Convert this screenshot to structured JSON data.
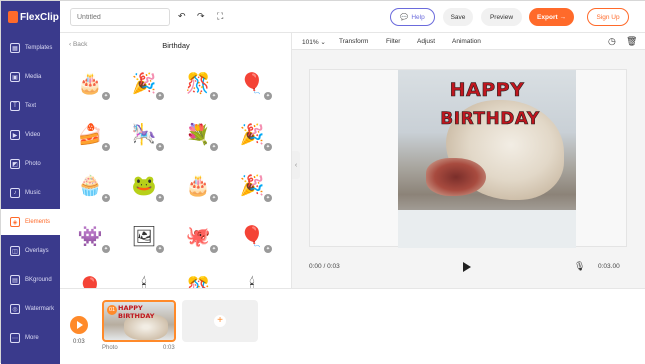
{
  "app": {
    "brand": "FlexClip"
  },
  "sidebar": {
    "items": [
      {
        "label": "Templates",
        "icon": "templates-icon",
        "glyph": "▦"
      },
      {
        "label": "Media",
        "icon": "media-icon",
        "glyph": "▣"
      },
      {
        "label": "Text",
        "icon": "text-icon",
        "glyph": "T"
      },
      {
        "label": "Video",
        "icon": "video-icon",
        "glyph": "▶"
      },
      {
        "label": "Photo",
        "icon": "photo-icon",
        "glyph": "◩"
      },
      {
        "label": "Music",
        "icon": "music-icon",
        "glyph": "♪"
      },
      {
        "label": "Elements",
        "icon": "elements-icon",
        "glyph": "◈",
        "active": true
      },
      {
        "label": "Overlays",
        "icon": "overlays-icon",
        "glyph": "◫"
      },
      {
        "label": "BKground",
        "icon": "background-icon",
        "glyph": "▤"
      },
      {
        "label": "Watermark",
        "icon": "watermark-icon",
        "glyph": "◎"
      },
      {
        "label": "More",
        "icon": "more-icon",
        "glyph": "⋯"
      }
    ]
  },
  "topbar": {
    "title_placeholder": "Untitled",
    "help_label": "Help",
    "save_label": "Save",
    "preview_label": "Preview",
    "export_label": "Export →",
    "signup_label": "Sign Up"
  },
  "panel": {
    "back_label": "‹ Back",
    "title": "Birthday",
    "elements": [
      "🎂",
      "🎉",
      "🎊",
      "🎈",
      "🍰",
      "🎠",
      "💐",
      "🎉",
      "🧁",
      "🐸",
      "🎂",
      "🎉",
      "👾",
      "🖼",
      "🐙",
      "🎈",
      "🎈",
      "🕯",
      "🎊",
      "🕯"
    ]
  },
  "editor": {
    "zoom": "101%",
    "toolbar": [
      "Transform",
      "Filter",
      "Adjust",
      "Animation"
    ],
    "canvas_text_1": "HAPPY",
    "canvas_text_2": "BIRTHDAY",
    "time_current": "0:00 / 0:03",
    "time_total": "0:03.00"
  },
  "timeline": {
    "total_time": "0:03",
    "clips": [
      {
        "number": "01",
        "label": "Photo",
        "duration": "0:03",
        "caption": "HAPPY BIRTHDAY"
      }
    ]
  },
  "colors": {
    "sidebar_bg": "#3a3a8c",
    "accent": "#ff6a2a",
    "help_purple": "#6b6bdc",
    "title_red": "#c0161e"
  }
}
